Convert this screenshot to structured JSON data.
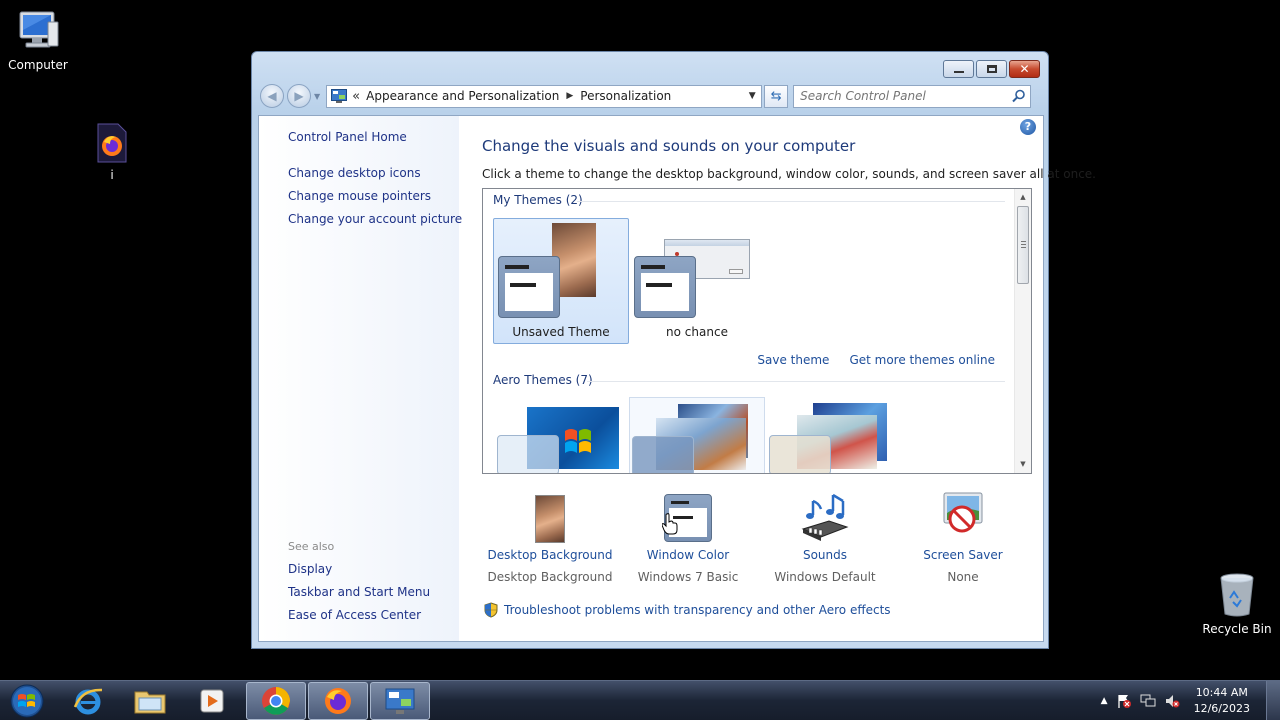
{
  "desktop": {
    "icons": [
      {
        "label": "Computer",
        "icon": "computer-icon"
      },
      {
        "label": "i",
        "icon": "firefox-file-icon"
      },
      {
        "label": "Recycle Bin",
        "icon": "recycle-bin-icon"
      }
    ]
  },
  "window": {
    "breadcrumb": {
      "overflow": "«",
      "items": [
        "Appearance and Personalization",
        "Personalization"
      ]
    },
    "search_placeholder": "Search Control Panel",
    "left_pane": {
      "links": [
        "Control Panel Home",
        "Change desktop icons",
        "Change mouse pointers",
        "Change your account picture"
      ],
      "see_also_label": "See also",
      "see_also": [
        "Display",
        "Taskbar and Start Menu",
        "Ease of Access Center"
      ]
    },
    "heading": "Change the visuals and sounds on your computer",
    "subtext": "Click a theme to change the desktop background, window color, sounds, and screen saver all at once.",
    "my_themes": {
      "label": "My Themes (2)",
      "items": [
        {
          "name": "Unsaved Theme",
          "selected": true
        },
        {
          "name": "no chance",
          "selected": false
        }
      ],
      "save_link": "Save theme",
      "more_link": "Get more themes online"
    },
    "aero_themes": {
      "label": "Aero Themes (7)"
    },
    "bottom_items": [
      {
        "title": "Desktop Background",
        "value": "Desktop Background",
        "icon": "desktop-background-icon"
      },
      {
        "title": "Window Color",
        "value": "Windows 7 Basic",
        "icon": "window-color-icon"
      },
      {
        "title": "Sounds",
        "value": "Windows Default",
        "icon": "sounds-icon"
      },
      {
        "title": "Screen Saver",
        "value": "None",
        "icon": "screen-saver-icon"
      }
    ],
    "troubleshoot": "Troubleshoot problems with transparency and other Aero effects"
  },
  "taskbar": {
    "apps": [
      "internet-explorer-icon",
      "windows-explorer-icon",
      "media-player-icon",
      "chrome-icon",
      "firefox-icon",
      "control-panel-icon"
    ],
    "clock": {
      "time": "10:44 AM",
      "date": "12/6/2023"
    }
  }
}
